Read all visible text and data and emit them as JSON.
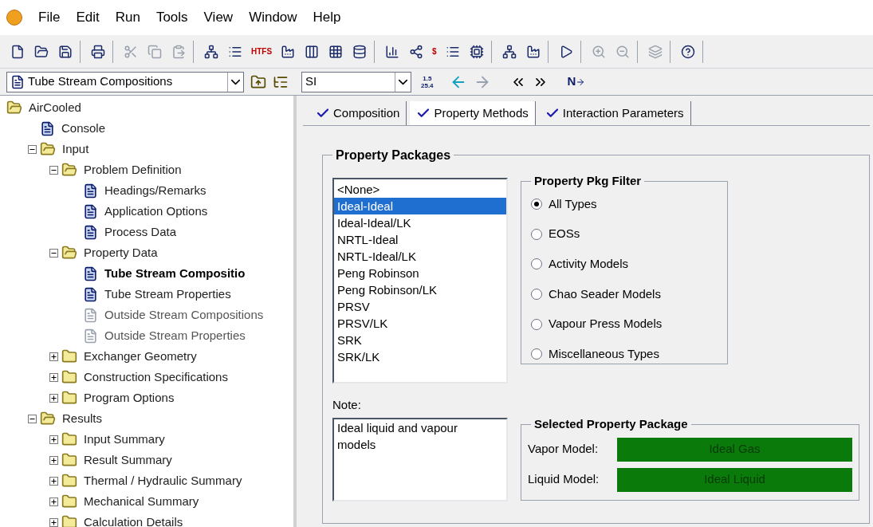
{
  "menu": [
    "File",
    "Edit",
    "Run",
    "Tools",
    "View",
    "Window",
    "Help"
  ],
  "toolbar": [
    [
      {
        "kind": "icon",
        "disabled": false
      },
      {
        "kind": "icon",
        "disabled": false
      },
      {
        "kind": "icon",
        "disabled": false
      }
    ],
    [
      {
        "kind": "icon",
        "disabled": false
      }
    ],
    [
      {
        "kind": "icon",
        "disabled": true
      },
      {
        "kind": "icon",
        "disabled": true
      },
      {
        "kind": "icon",
        "disabled": true
      }
    ],
    [
      {
        "kind": "icon",
        "disabled": false
      },
      {
        "kind": "icon",
        "disabled": false
      },
      {
        "kind": "text",
        "text": "HTFS"
      },
      {
        "kind": "icon",
        "disabled": false
      },
      {
        "kind": "icon",
        "disabled": false
      },
      {
        "kind": "icon",
        "disabled": false
      },
      {
        "kind": "icon",
        "disabled": false
      }
    ],
    [
      {
        "kind": "icon",
        "disabled": false
      },
      {
        "kind": "icon",
        "disabled": false
      },
      {
        "kind": "text",
        "text": "$"
      },
      {
        "kind": "icon",
        "disabled": false
      },
      {
        "kind": "icon",
        "disabled": false
      }
    ],
    [
      {
        "kind": "icon",
        "disabled": false
      },
      {
        "kind": "icon",
        "disabled": false
      }
    ],
    [
      {
        "kind": "icon",
        "disabled": false
      }
    ],
    [
      {
        "kind": "icon",
        "disabled": true
      },
      {
        "kind": "icon",
        "disabled": true
      }
    ],
    [
      {
        "kind": "icon",
        "disabled": true
      }
    ],
    [
      {
        "kind": "icon",
        "disabled": false
      }
    ]
  ],
  "navbar": {
    "form_select": "Tube Stream Compositions",
    "units_select": "SI",
    "units_icon": [
      "1.5",
      "25.4"
    ],
    "next_label": "N"
  },
  "tree": [
    {
      "label": "AirCooled",
      "kind": "folder",
      "expanded": true,
      "selected": false,
      "children": [
        {
          "label": "Console",
          "kind": "form",
          "selected": false,
          "disabled": false
        },
        {
          "label": "Input",
          "kind": "folder",
          "expanded": true,
          "selected": false,
          "children": [
            {
              "label": "Problem Definition",
              "kind": "folder",
              "expanded": true,
              "selected": false,
              "children": [
                {
                  "label": "Headings/Remarks",
                  "kind": "form",
                  "selected": false,
                  "disabled": false
                },
                {
                  "label": "Application Options",
                  "kind": "form",
                  "selected": false,
                  "disabled": false
                },
                {
                  "label": "Process Data",
                  "kind": "form",
                  "selected": false,
                  "disabled": false
                }
              ]
            },
            {
              "label": "Property Data",
              "kind": "folder",
              "expanded": true,
              "selected": false,
              "children": [
                {
                  "label": "Tube Stream Compositio",
                  "kind": "form",
                  "selected": true,
                  "disabled": false
                },
                {
                  "label": "Tube Stream Properties",
                  "kind": "form",
                  "selected": false,
                  "disabled": false
                },
                {
                  "label": "Outside Stream Compositions",
                  "kind": "form",
                  "selected": false,
                  "disabled": true
                },
                {
                  "label": "Outside Stream Properties",
                  "kind": "form",
                  "selected": false,
                  "disabled": true
                }
              ]
            },
            {
              "label": "Exchanger Geometry",
              "kind": "folder",
              "expanded": false,
              "selected": false
            },
            {
              "label": "Construction Specifications",
              "kind": "folder",
              "expanded": false,
              "selected": false
            },
            {
              "label": "Program Options",
              "kind": "folder",
              "expanded": false,
              "selected": false
            }
          ]
        },
        {
          "label": "Results",
          "kind": "folder",
          "expanded": true,
          "selected": false,
          "children": [
            {
              "label": "Input Summary",
              "kind": "folder",
              "expanded": false,
              "selected": false
            },
            {
              "label": "Result Summary",
              "kind": "folder",
              "expanded": false,
              "selected": false
            },
            {
              "label": "Thermal / Hydraulic Summary",
              "kind": "folder",
              "expanded": false,
              "selected": false
            },
            {
              "label": "Mechanical Summary",
              "kind": "folder",
              "expanded": false,
              "selected": false
            },
            {
              "label": "Calculation Details",
              "kind": "folder",
              "expanded": false,
              "selected": false
            }
          ]
        }
      ]
    }
  ],
  "tabs": [
    {
      "label": "Composition",
      "checked": true,
      "selected": false
    },
    {
      "label": "Property Methods",
      "checked": true,
      "selected": true
    },
    {
      "label": "Interaction Parameters",
      "checked": true,
      "selected": false
    }
  ],
  "property_packages": {
    "title": "Property Packages",
    "list": [
      {
        "label": "<None>",
        "selected": false
      },
      {
        "label": "Ideal-Ideal",
        "selected": true
      },
      {
        "label": "Ideal-Ideal/LK",
        "selected": false
      },
      {
        "label": "NRTL-Ideal",
        "selected": false
      },
      {
        "label": "NRTL-Ideal/LK",
        "selected": false
      },
      {
        "label": "Peng Robinson",
        "selected": false
      },
      {
        "label": "Peng Robinson/LK",
        "selected": false
      },
      {
        "label": "PRSV",
        "selected": false
      },
      {
        "label": "PRSV/LK",
        "selected": false
      },
      {
        "label": "SRK",
        "selected": false
      },
      {
        "label": "SRK/LK",
        "selected": false
      }
    ],
    "filter": {
      "title": "Property Pkg Filter",
      "options": [
        {
          "label": "All Types",
          "selected": true
        },
        {
          "label": "EOSs",
          "selected": false
        },
        {
          "label": "Activity Models",
          "selected": false
        },
        {
          "label": "Chao Seader Models",
          "selected": false
        },
        {
          "label": "Vapour Press Models",
          "selected": false
        },
        {
          "label": "Miscellaneous Types",
          "selected": false
        }
      ]
    },
    "note_label": "Note:",
    "note": "Ideal liquid and vapour models",
    "selected_package": {
      "title": "Selected Property Package",
      "rows": [
        {
          "label": "Vapor Model:",
          "value": "Ideal Gas",
          "color": "#0a7a0a"
        },
        {
          "label": "Liquid Model:",
          "value": "Ideal Liquid",
          "color": "#0a7a0a"
        }
      ]
    }
  }
}
